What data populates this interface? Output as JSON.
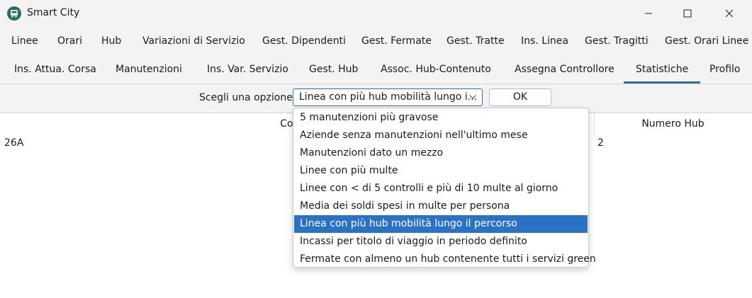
{
  "window": {
    "title": "Smart City"
  },
  "tabs_row1": [
    "Linee",
    "Orari",
    "Hub",
    "Variazioni di Servizio",
    "Gest. Dipendenti",
    "Gest. Fermate",
    "Gest. Tratte",
    "Ins. Linea",
    "Gest. Tragitti",
    "Gest. Orari Linee"
  ],
  "tabs_row2": [
    "Ins. Attua. Corsa",
    "Manutenzioni",
    "Ins. Var. Servizio",
    "Gest. Hub",
    "Assoc. Hub-Contenuto",
    "Assegna Controllore",
    "Statistiche",
    "Profilo"
  ],
  "active_tab": "Statistiche",
  "toolbar": {
    "label": "Scegli una opzione",
    "selected_value": "Linea con più hub mobilità lungo i...",
    "ok_label": "OK"
  },
  "table": {
    "headers": [
      "Codice",
      "Numero Hub"
    ],
    "rows": [
      [
        "26A",
        "2"
      ]
    ]
  },
  "dropdown": {
    "options": [
      "5 manutenzioni più gravose",
      "Aziende senza manutenzioni nell'ultimo mese",
      "Manutenzioni dato un mezzo",
      "Linee con più multe",
      "Linee con < di 5 controlli e più di 10 multe al giorno",
      "Media dei soldi spesi in multe per persona",
      "Linea con più hub mobilità lungo il percorso",
      "Incassi per titolo di viaggio in periodo definito",
      "Fermate con almeno un hub contenente tutti i servizi green"
    ],
    "selected_index": 6
  },
  "colors": {
    "accent": "#2a72c4",
    "tab_indicator": "#2f6fa8"
  }
}
